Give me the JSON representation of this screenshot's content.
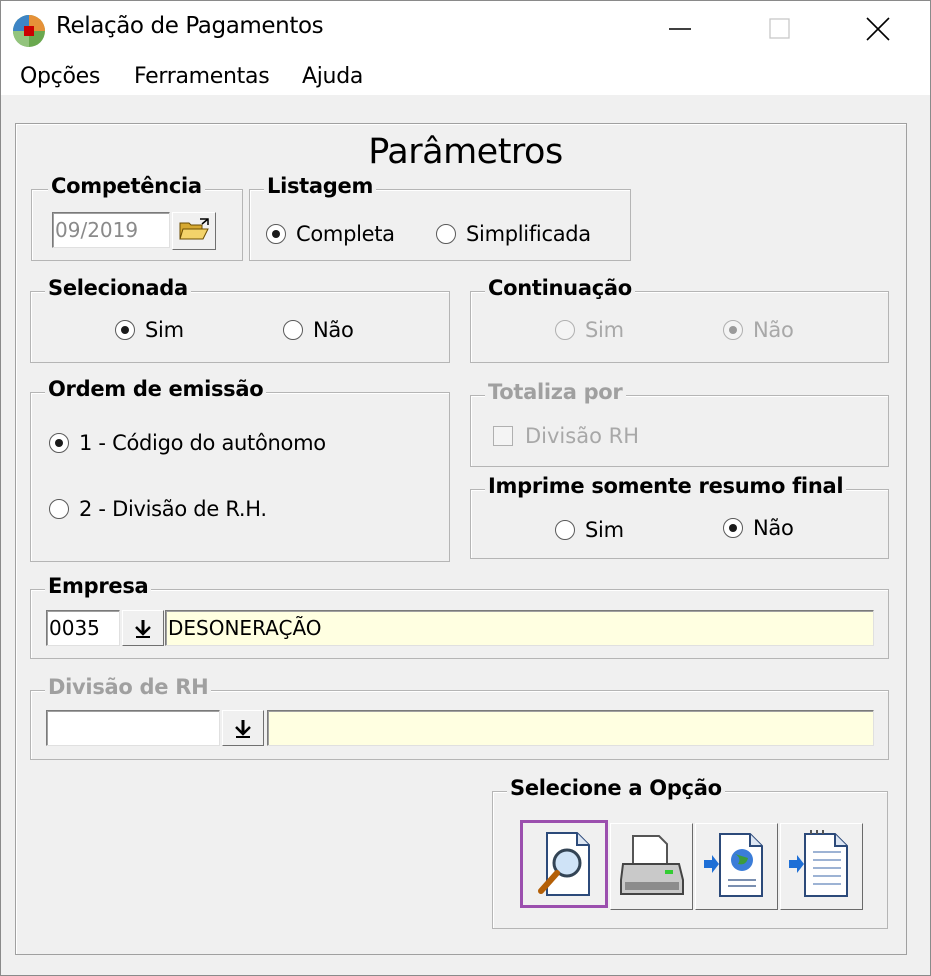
{
  "window": {
    "title": "Relação de Pagamentos"
  },
  "menu": [
    "Opções",
    "Ferramentas",
    "Ajuda"
  ],
  "heading": "Parâmetros",
  "competencia": {
    "label": "Competência",
    "value": "09/2019"
  },
  "listagem": {
    "label": "Listagem",
    "options": [
      "Completa",
      "Simplificada"
    ],
    "selected": "Completa"
  },
  "selecionada": {
    "label": "Selecionada",
    "options": [
      "Sim",
      "Não"
    ],
    "selected": "Sim"
  },
  "continuacao": {
    "label": "Continuação",
    "options": [
      "Sim",
      "Não"
    ],
    "selected": "Não",
    "disabled": true
  },
  "ordem": {
    "label": "Ordem de emissão",
    "options": [
      "1 - Código do autônomo",
      "2 - Divisão de R.H."
    ],
    "selected": "1 - Código do autônomo"
  },
  "totaliza": {
    "label": "Totaliza por",
    "checkbox": "Divisão RH",
    "checked": false,
    "disabled": true
  },
  "resumo": {
    "label": "Imprime somente resumo final",
    "options": [
      "Sim",
      "Não"
    ],
    "selected": "Não"
  },
  "empresa": {
    "label": "Empresa",
    "code": "0035",
    "name": "DESONERAÇÃO"
  },
  "divisao": {
    "label": "Divisão de RH",
    "code": "",
    "name": "",
    "disabled": true
  },
  "opcao": {
    "label": "Selecione a Opção",
    "tools": [
      "preview-icon",
      "printer-icon",
      "export-web-icon",
      "export-text-icon"
    ],
    "selected": "preview-icon"
  },
  "colors": {
    "highlight": "#9b4fae",
    "lookup_field": "#ffffe1"
  }
}
